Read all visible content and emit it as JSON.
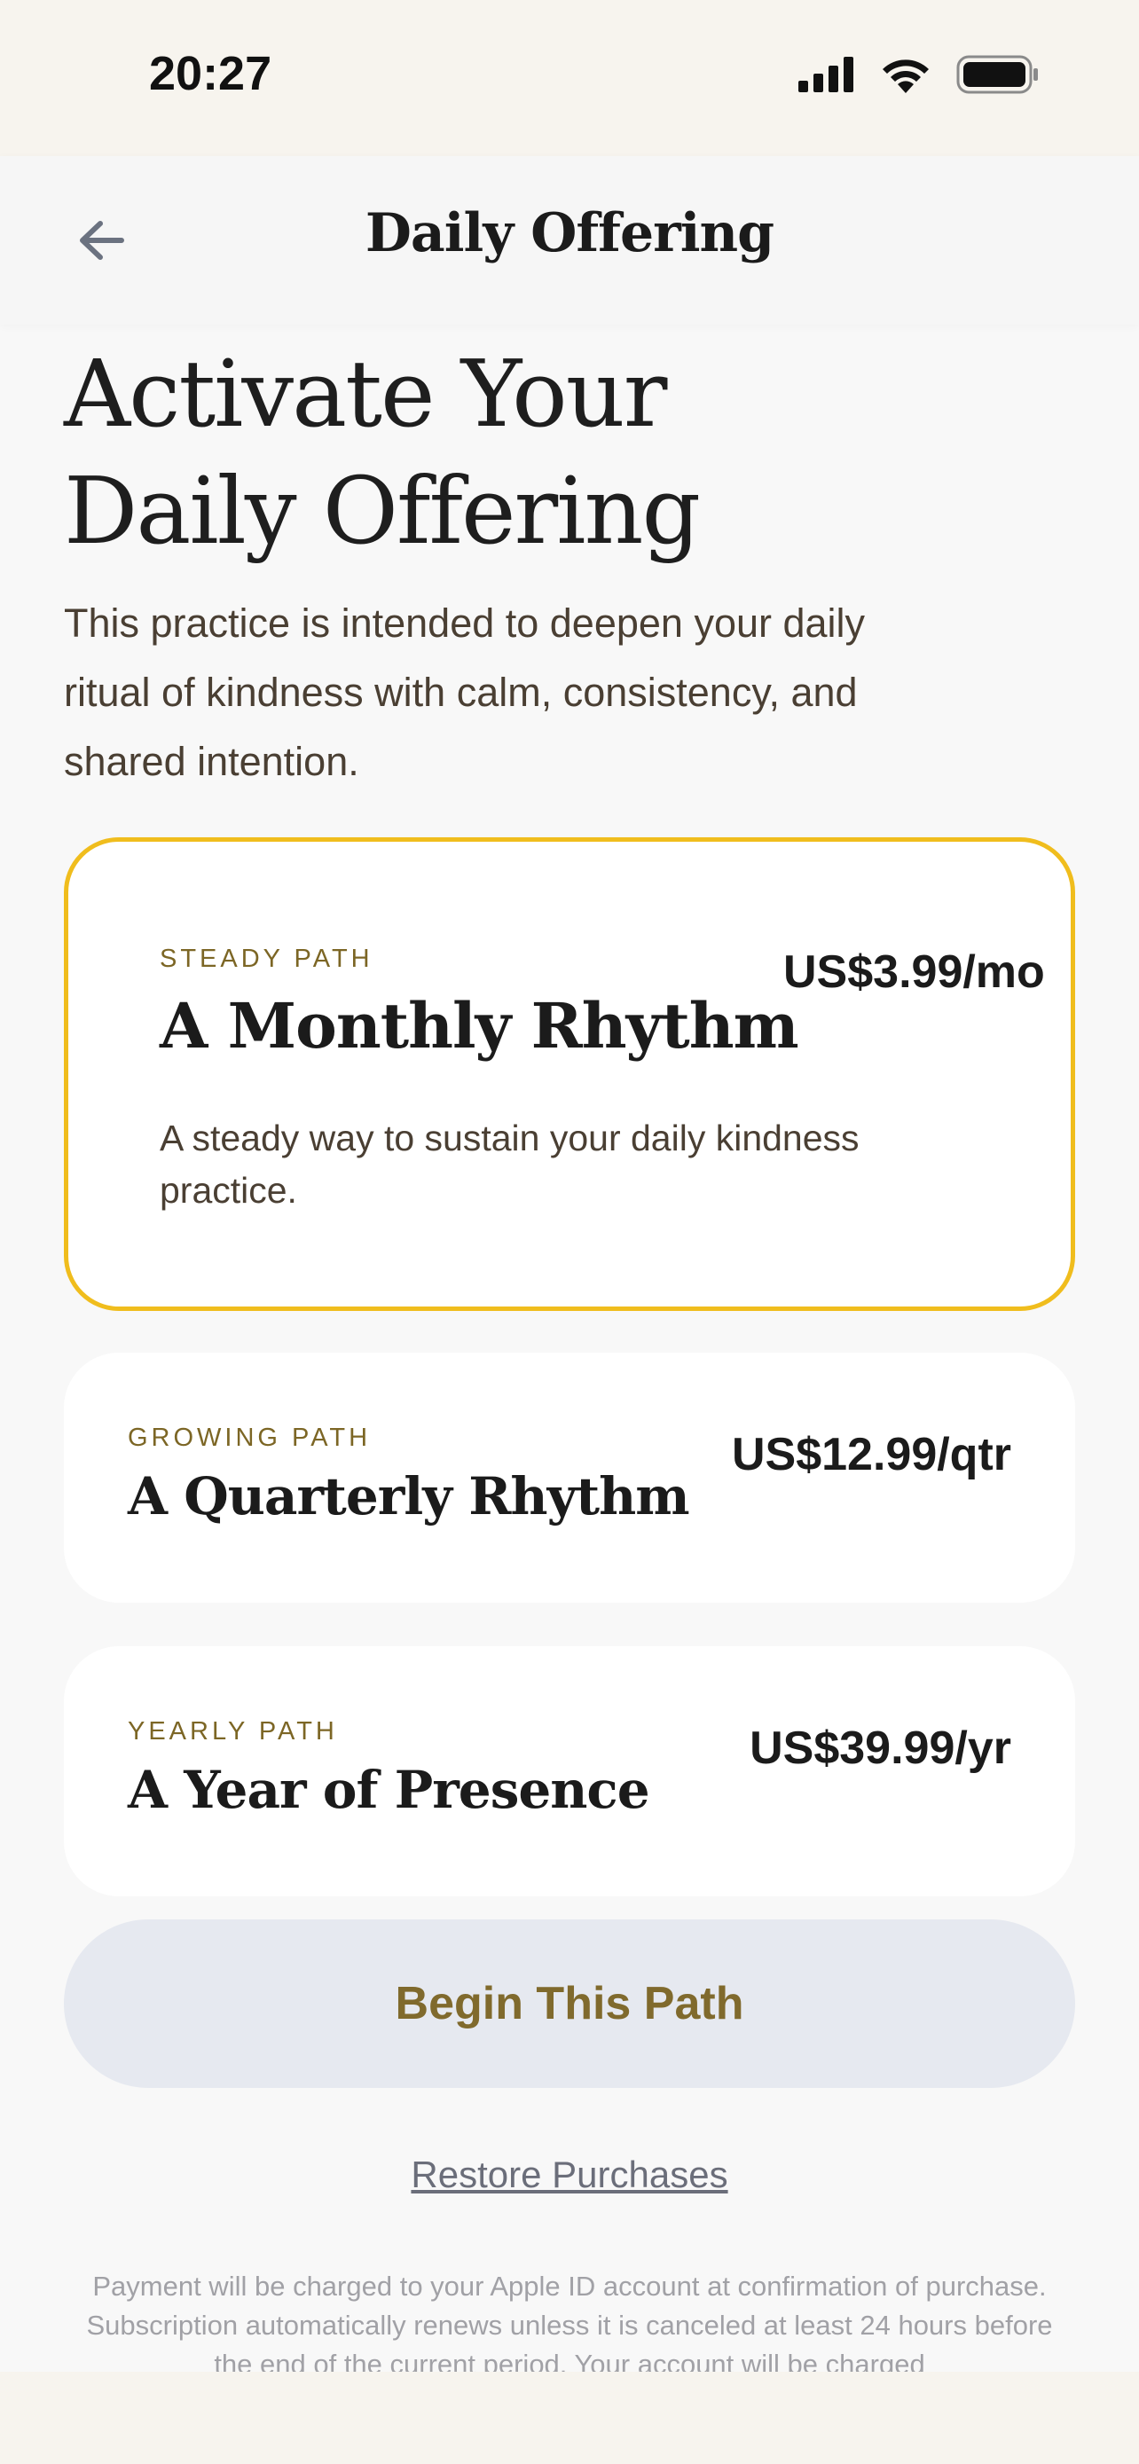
{
  "status_bar": {
    "time": "20:27"
  },
  "nav": {
    "title": "Daily Offering"
  },
  "hero": {
    "headline_line1": "Activate Your",
    "headline_line2": "Daily Offering",
    "intro": "This practice is intended to deepen your daily ritual of kindness with calm, consistency, and shared intention."
  },
  "plans": {
    "monthly": {
      "eyebrow": "STEADY PATH",
      "title": "A Monthly Rhythm",
      "price": "US$3.99/mo",
      "description": "A steady way to sustain your daily kindness practice."
    },
    "quarterly": {
      "eyebrow": "GROWING PATH",
      "title": "A Quarterly Rhythm",
      "price": "US$12.99/qtr"
    },
    "yearly": {
      "eyebrow": "YEARLY PATH",
      "title": "A Year of Presence",
      "price": "US$39.99/yr"
    }
  },
  "actions": {
    "cta_label": "Begin This Path",
    "restore_label": "Restore Purchases"
  },
  "legal": {
    "text": "Payment will be charged to your Apple ID account at confirmation of purchase. Subscription automatically renews unless it is canceled at least 24 hours before the end of the current period. Your account will be charged"
  },
  "colors": {
    "selected_border": "#f0bd1d",
    "eyebrow": "#7c6625",
    "cta_text": "#806a2d",
    "cta_background": "#e6e9f0",
    "header_background": "#f7f4ee"
  },
  "icons": {
    "back": "arrow-left-icon",
    "signal": "cellular-signal-icon",
    "wifi": "wifi-icon",
    "battery": "battery-icon"
  }
}
